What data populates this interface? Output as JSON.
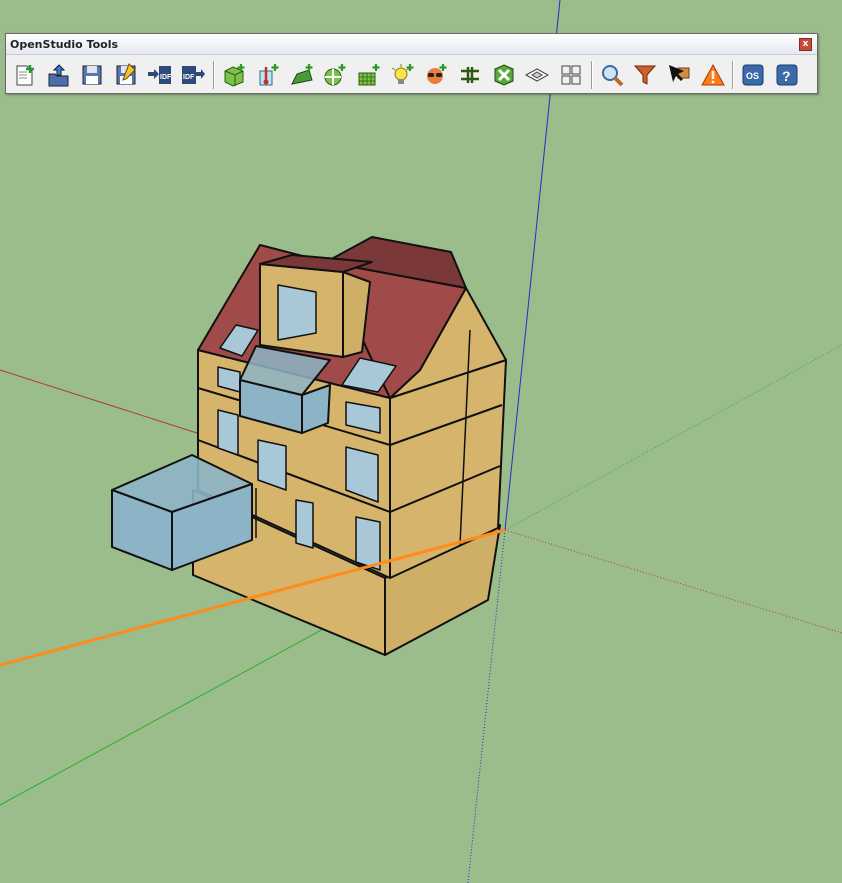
{
  "window": {
    "background": "#9bbd8c"
  },
  "toolbar": {
    "title": "OpenStudio Tools",
    "close_label": "x",
    "groups": [
      [
        "new-file-icon",
        "import-icon",
        "save-icon",
        "save-as-icon",
        "export-idf-icon",
        "import-idf-icon"
      ],
      [
        "new-space-icon",
        "new-thermal-zone-icon",
        "new-shading-icon",
        "new-interior-partition-icon",
        "new-daylighting-control-icon",
        "new-illuminance-map-icon",
        "new-luminaire-icon",
        "new-glare-sensor-icon",
        "surface-matching-icon",
        "project-loose-geometry-icon",
        "space-diagram-icon"
      ],
      [
        "inspector-icon",
        "render-filter-icon",
        "select-tool-icon",
        "warning-icon"
      ],
      [
        "openstudio-app-icon",
        "help-icon"
      ]
    ]
  },
  "scene": {
    "colors": {
      "wall": "#d6b46c",
      "wall_side": "#c9a760",
      "roof": "#a04a4a",
      "roof_dark": "#7a3838",
      "glass": "#a8c8d8",
      "box": "#8db4c6",
      "axis_red": "#b33a3a",
      "axis_green": "#2cae2c",
      "axis_blue": "#2a2acc",
      "selection": "#ff8c1a"
    }
  }
}
